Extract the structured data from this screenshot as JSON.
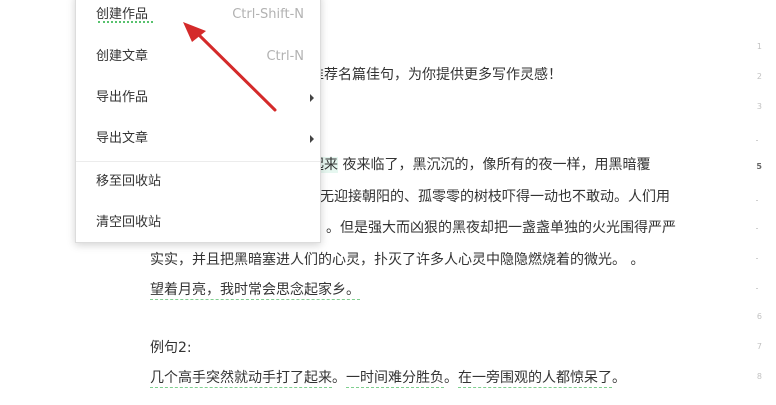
{
  "context_menu": {
    "items": [
      {
        "label": "创建作品",
        "shortcut": "Ctrl-Shift-N"
      },
      {
        "label": "创建文章",
        "shortcut": "Ctrl-N"
      },
      {
        "label": "导出作品",
        "shortcut": ""
      },
      {
        "label": "导出文章",
        "shortcut": ""
      },
      {
        "label": "移至回收站",
        "shortcut": ""
      },
      {
        "label": "清空回收站",
        "shortcut": ""
      }
    ]
  },
  "document": {
    "line_intro": "推荐名篇佳句，为你提供更多写作灵感！",
    "para1_line1_hl": "起来",
    "para1_line1": " 夜来临了，黑沉沉的，像所有的夜一样，用黑暗覆",
    "para1_line2": "无迎接朝阳的、孤零零的树枝吓得一动也不敢动。人们用",
    "para1_line3": "。但是强大而凶狠的黑夜却把一盏盏单独的火光围得严严",
    "para1_line4": "实实，并且把黑暗塞进人们的心灵，扑灭了许多人心灵中隐隐燃烧着的微光。 。",
    "para1_line5": "望着月亮，我时常会思念起家乡。",
    "example2_label": "例句2:",
    "example2_p1": "几个高手突然就动手打了起来",
    "example2_p2": "。",
    "example2_p3": "一时间难分胜负",
    "example2_p4": "。",
    "example2_p5": "在一旁围观的人都惊呆了",
    "example2_p6": "。"
  },
  "gutter": {
    "numbers": [
      "1",
      "2",
      "3",
      "4",
      "5",
      "6",
      "7",
      "8"
    ],
    "current_line": "5"
  },
  "colors": {
    "pointer": "#d42a2a",
    "underline": "#7fcf8f",
    "highlight": "#e6f7f0"
  }
}
